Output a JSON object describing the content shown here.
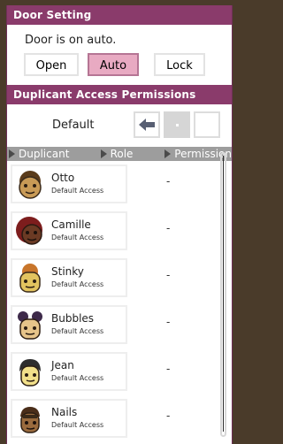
{
  "door_setting": {
    "title": "Door Setting",
    "status_text": "Door is on auto.",
    "buttons": {
      "open": "Open",
      "auto": "Auto",
      "lock": "Lock"
    },
    "selected": "auto"
  },
  "access_permissions": {
    "title": "Duplicant Access Permissions",
    "default_label": "Default"
  },
  "table": {
    "columns": [
      "Duplicant",
      "Role",
      "Permission"
    ],
    "rows": [
      {
        "name": "Otto",
        "access": "Default Access",
        "permission": "-"
      },
      {
        "name": "Camille",
        "access": "Default Access",
        "permission": "-"
      },
      {
        "name": "Stinky",
        "access": "Default Access",
        "permission": "-"
      },
      {
        "name": "Bubbles",
        "access": "Default Access",
        "permission": "-"
      },
      {
        "name": "Jean",
        "access": "Default Access",
        "permission": "-"
      },
      {
        "name": "Nails",
        "access": "Default Access",
        "permission": "-"
      }
    ]
  },
  "colors": {
    "header_bg": "#8a3b6b",
    "active_button": "#e8aac2",
    "table_header_bg": "#9d9d9d"
  },
  "icons": {
    "default_left": "arrow-left-icon",
    "default_middle": "dot-icon",
    "avatar": "duplicant-avatar-icon"
  }
}
